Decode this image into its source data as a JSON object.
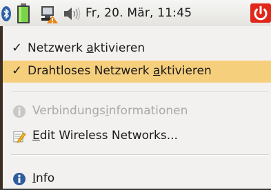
{
  "panel": {
    "clock": "Fr, 20. Mär, 11:45",
    "icons": [
      "bluetooth-icon",
      "battery-icon",
      "network-icon",
      "volume-icon",
      "power-icon"
    ]
  },
  "menu": {
    "items": [
      {
        "pre": "Netzwerk ",
        "mnemonic": "a",
        "post": "ktivieren",
        "checked": true,
        "selected": false
      },
      {
        "pre": "Drahtloses Netzwerk ",
        "mnemonic": "a",
        "post": "ktivieren",
        "checked": true,
        "selected": true
      },
      {
        "pre": "Verbindungs",
        "mnemonic": "i",
        "post": "nformationen",
        "enabled": false,
        "icon": "info-icon"
      },
      {
        "pre": "",
        "mnemonic": "E",
        "post": "dit Wireless Networks...",
        "icon": "edit-icon"
      },
      {
        "pre": "",
        "mnemonic": "I",
        "post": "nfo",
        "icon": "info-icon"
      }
    ]
  },
  "colors": {
    "selection": "#f6cf7d",
    "disabled_text": "#a9a9a5",
    "power_red": "#e0271a",
    "info_blue": "#2f5c9e"
  }
}
